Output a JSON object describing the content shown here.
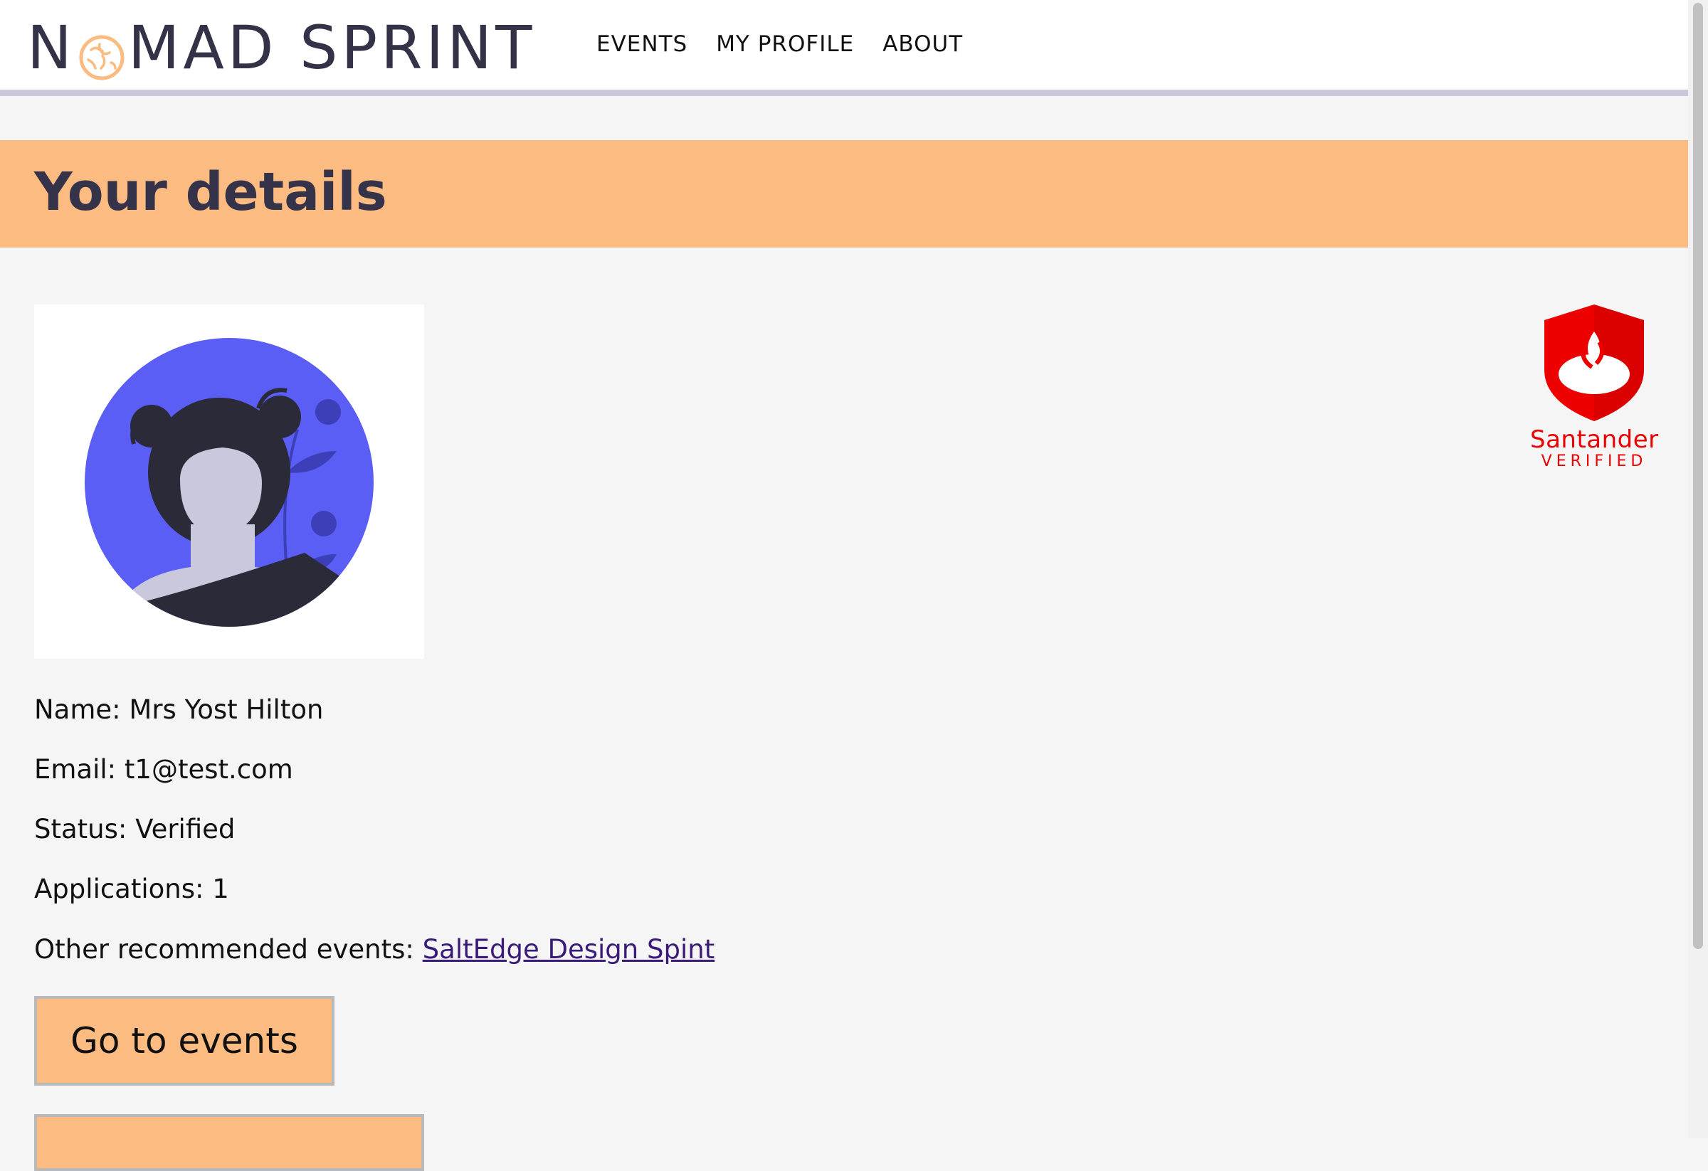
{
  "header": {
    "logo": {
      "before": "N",
      "after": "MAD SPRINT",
      "accent_color": "#fcbb80",
      "text_color": "#343247"
    },
    "nav": [
      {
        "label": "EVENTS"
      },
      {
        "label": "MY PROFILE"
      },
      {
        "label": "ABOUT"
      }
    ]
  },
  "page": {
    "title": "Your details",
    "banner_color": "#fcbb80"
  },
  "badge": {
    "brand": "Santander",
    "status": "VERIFIED",
    "color": "#ec0000"
  },
  "details": {
    "name_label": "Name: ",
    "name_value": "Mrs Yost Hilton",
    "email_label": "Email: ",
    "email_value": "t1@test.com",
    "status_label": "Status: ",
    "status_value": "Verified",
    "applications_label": "Applications: ",
    "applications_value": "1",
    "recommended_label": "Other recommended events: ",
    "recommended_link": "SaltEdge Design Spint"
  },
  "actions": {
    "go_to_events": "Go to events",
    "second_button": ""
  }
}
